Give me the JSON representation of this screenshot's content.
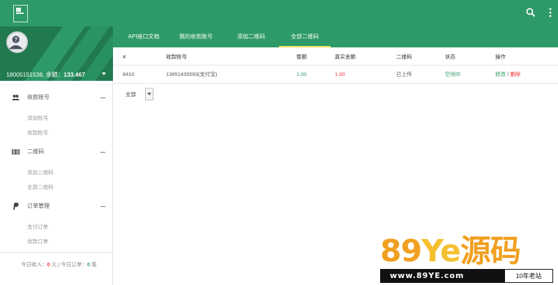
{
  "header": {
    "logo": "logo-icon",
    "search_icon": "search-icon",
    "more_icon": "more-icon"
  },
  "user": {
    "account": "18005151538",
    "balance_label": "余额：",
    "balance": "133.467"
  },
  "sidebar": {
    "sections": [
      {
        "label": "收款账号",
        "icon": "users-icon",
        "items": [
          "添加账号",
          "收款账号"
        ]
      },
      {
        "label": "二维码",
        "icon": "barcode-icon",
        "items": [
          "添加二维码",
          "全部二维码"
        ]
      },
      {
        "label": "订单管理",
        "icon": "paypal-icon",
        "items": [
          "支付订单",
          "收款订单"
        ]
      }
    ],
    "footer": {
      "income_label": "今日收入：",
      "income_value": "0",
      "income_unit": "元",
      "separator": "|",
      "orders_label": "今日订单：",
      "orders_value": "0",
      "orders_unit": "笔"
    }
  },
  "tabs": [
    {
      "label": "API接口文档",
      "active": false
    },
    {
      "label": "我的收款账号",
      "active": false
    },
    {
      "label": "添加二维码",
      "active": false
    },
    {
      "label": "全部二维码",
      "active": true
    }
  ],
  "table": {
    "headers": [
      "#",
      "收款账号",
      "整额",
      "真实金额",
      "二维码",
      "状态",
      "操作"
    ],
    "rows": [
      {
        "id": "8410",
        "account": "13851435593(支付宝)",
        "amount": "1.00",
        "real_amount": "1.00",
        "qrcode": "已上传",
        "status": "空闲中",
        "edit": "修改",
        "slash": "/",
        "delete": "删除"
      }
    ]
  },
  "filter": {
    "label": "全部",
    "selected": ""
  },
  "watermark": {
    "big_a": "89",
    "big_b": "Ye",
    "big_c": "源码",
    "url": "www.89YE.com",
    "tag": "10年老站"
  },
  "colors": {
    "primary": "#2e9a67",
    "dark": "#217a4f",
    "red": "#e33333",
    "tab_active_underline": "#f5e663"
  }
}
